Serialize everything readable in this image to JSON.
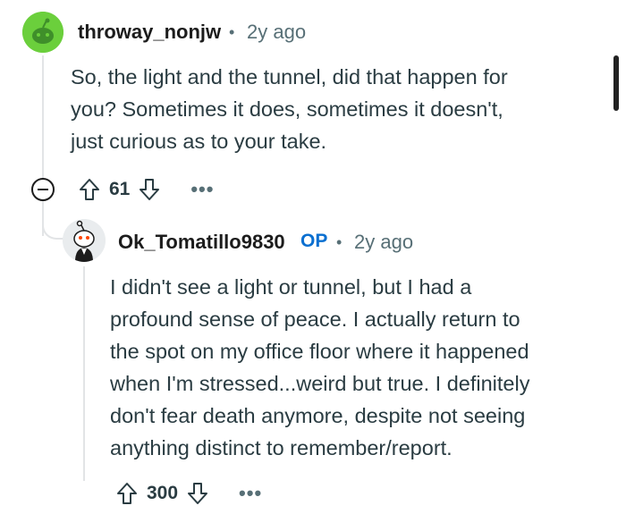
{
  "comment1": {
    "username": "throway_nonjw",
    "separator": "•",
    "time": "2y ago",
    "body_lines": [
      "So, the light and the tunnel, did that happen for",
      "you? Sometimes it does, sometimes it doesn't,",
      "just curious as to your take."
    ],
    "votes": "61",
    "more": "•••"
  },
  "reply": {
    "username": "Ok_Tomatillo9830",
    "op_label": "OP",
    "separator": "•",
    "time": "2y ago",
    "body_lines": [
      "I didn't see a light or tunnel, but I had a",
      "profound sense of peace. I actually return to",
      "the spot on my office floor where it happened",
      "when I'm stressed...weird but true. I definitely",
      "don't fear death anymore, despite not seeing",
      "anything distinct to remember/report."
    ],
    "votes": "300",
    "more": "•••"
  },
  "colors": {
    "avatar1_bg": "#6bcf3c",
    "op_blue": "#0a6fd0",
    "meta_gray": "#576f76",
    "thread_line": "#e2e4e6"
  },
  "icons": [
    "snoo-avatar-icon",
    "upvote-icon",
    "downvote-icon",
    "collapse-icon",
    "more-icon"
  ]
}
